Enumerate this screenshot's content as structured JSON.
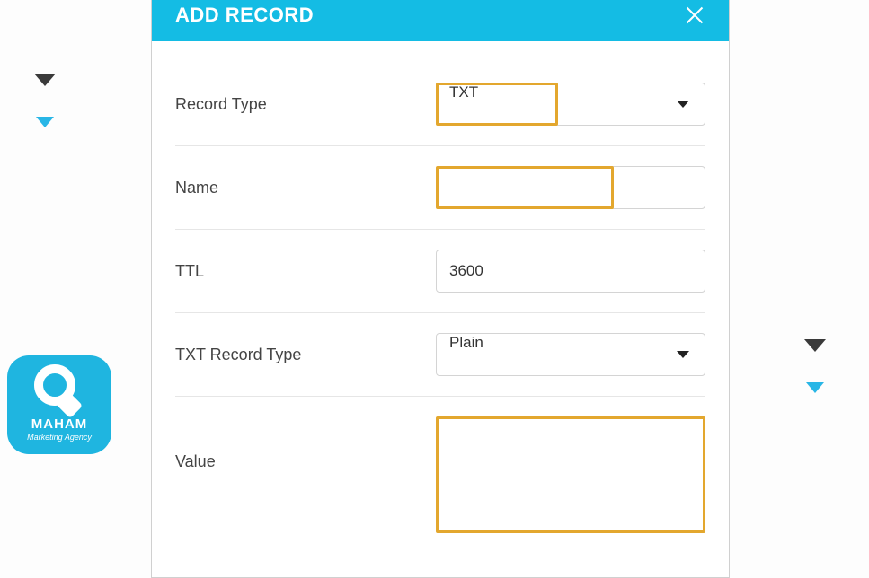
{
  "modal": {
    "title": "ADD RECORD",
    "fields": {
      "record_type": {
        "label": "Record Type",
        "value": "TXT"
      },
      "name": {
        "label": "Name",
        "value": ""
      },
      "ttl": {
        "label": "TTL",
        "value": "3600"
      },
      "txt_type": {
        "label": "TXT Record Type",
        "value": "Plain"
      },
      "value": {
        "label": "Value",
        "value": ""
      }
    }
  },
  "logo": {
    "name": "MAHAM",
    "tagline": "Marketing Agency"
  },
  "colors": {
    "accent": "#14bce4",
    "highlight": "#e3a72e"
  }
}
